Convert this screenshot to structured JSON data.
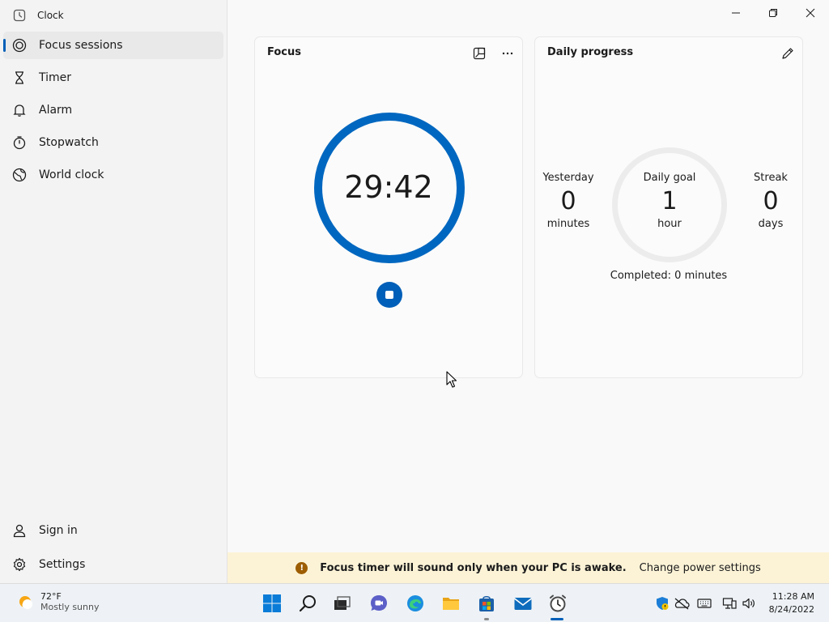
{
  "app": {
    "title": "Clock"
  },
  "sidebar": {
    "items": [
      {
        "label": "Focus sessions",
        "icon": "focus-icon",
        "selected": true
      },
      {
        "label": "Timer",
        "icon": "hourglass-icon"
      },
      {
        "label": "Alarm",
        "icon": "bell-icon"
      },
      {
        "label": "Stopwatch",
        "icon": "stopwatch-icon"
      },
      {
        "label": "World clock",
        "icon": "globe-icon"
      }
    ],
    "bottom": [
      {
        "label": "Sign in",
        "icon": "person-icon"
      },
      {
        "label": "Settings",
        "icon": "gear-icon"
      }
    ]
  },
  "focus_card": {
    "title": "Focus",
    "timer": "29:42"
  },
  "progress_card": {
    "title": "Daily progress",
    "yesterday": {
      "label": "Yesterday",
      "value": "0",
      "unit": "minutes"
    },
    "goal": {
      "label": "Daily goal",
      "value": "1",
      "unit": "hour"
    },
    "streak": {
      "label": "Streak",
      "value": "0",
      "unit": "days"
    },
    "completed": "Completed: 0 minutes"
  },
  "infobar": {
    "icon": "!",
    "message": "Focus timer will sound only when your PC is awake.",
    "link": "Change power settings"
  },
  "taskbar": {
    "weather": {
      "temp": "72°F",
      "desc": "Mostly sunny"
    },
    "clock": {
      "time": "11:28 AM",
      "date": "8/24/2022"
    }
  },
  "colors": {
    "accent": "#005fb8",
    "warning": "#9d5d00",
    "infobar_bg": "#fcf3d7"
  }
}
